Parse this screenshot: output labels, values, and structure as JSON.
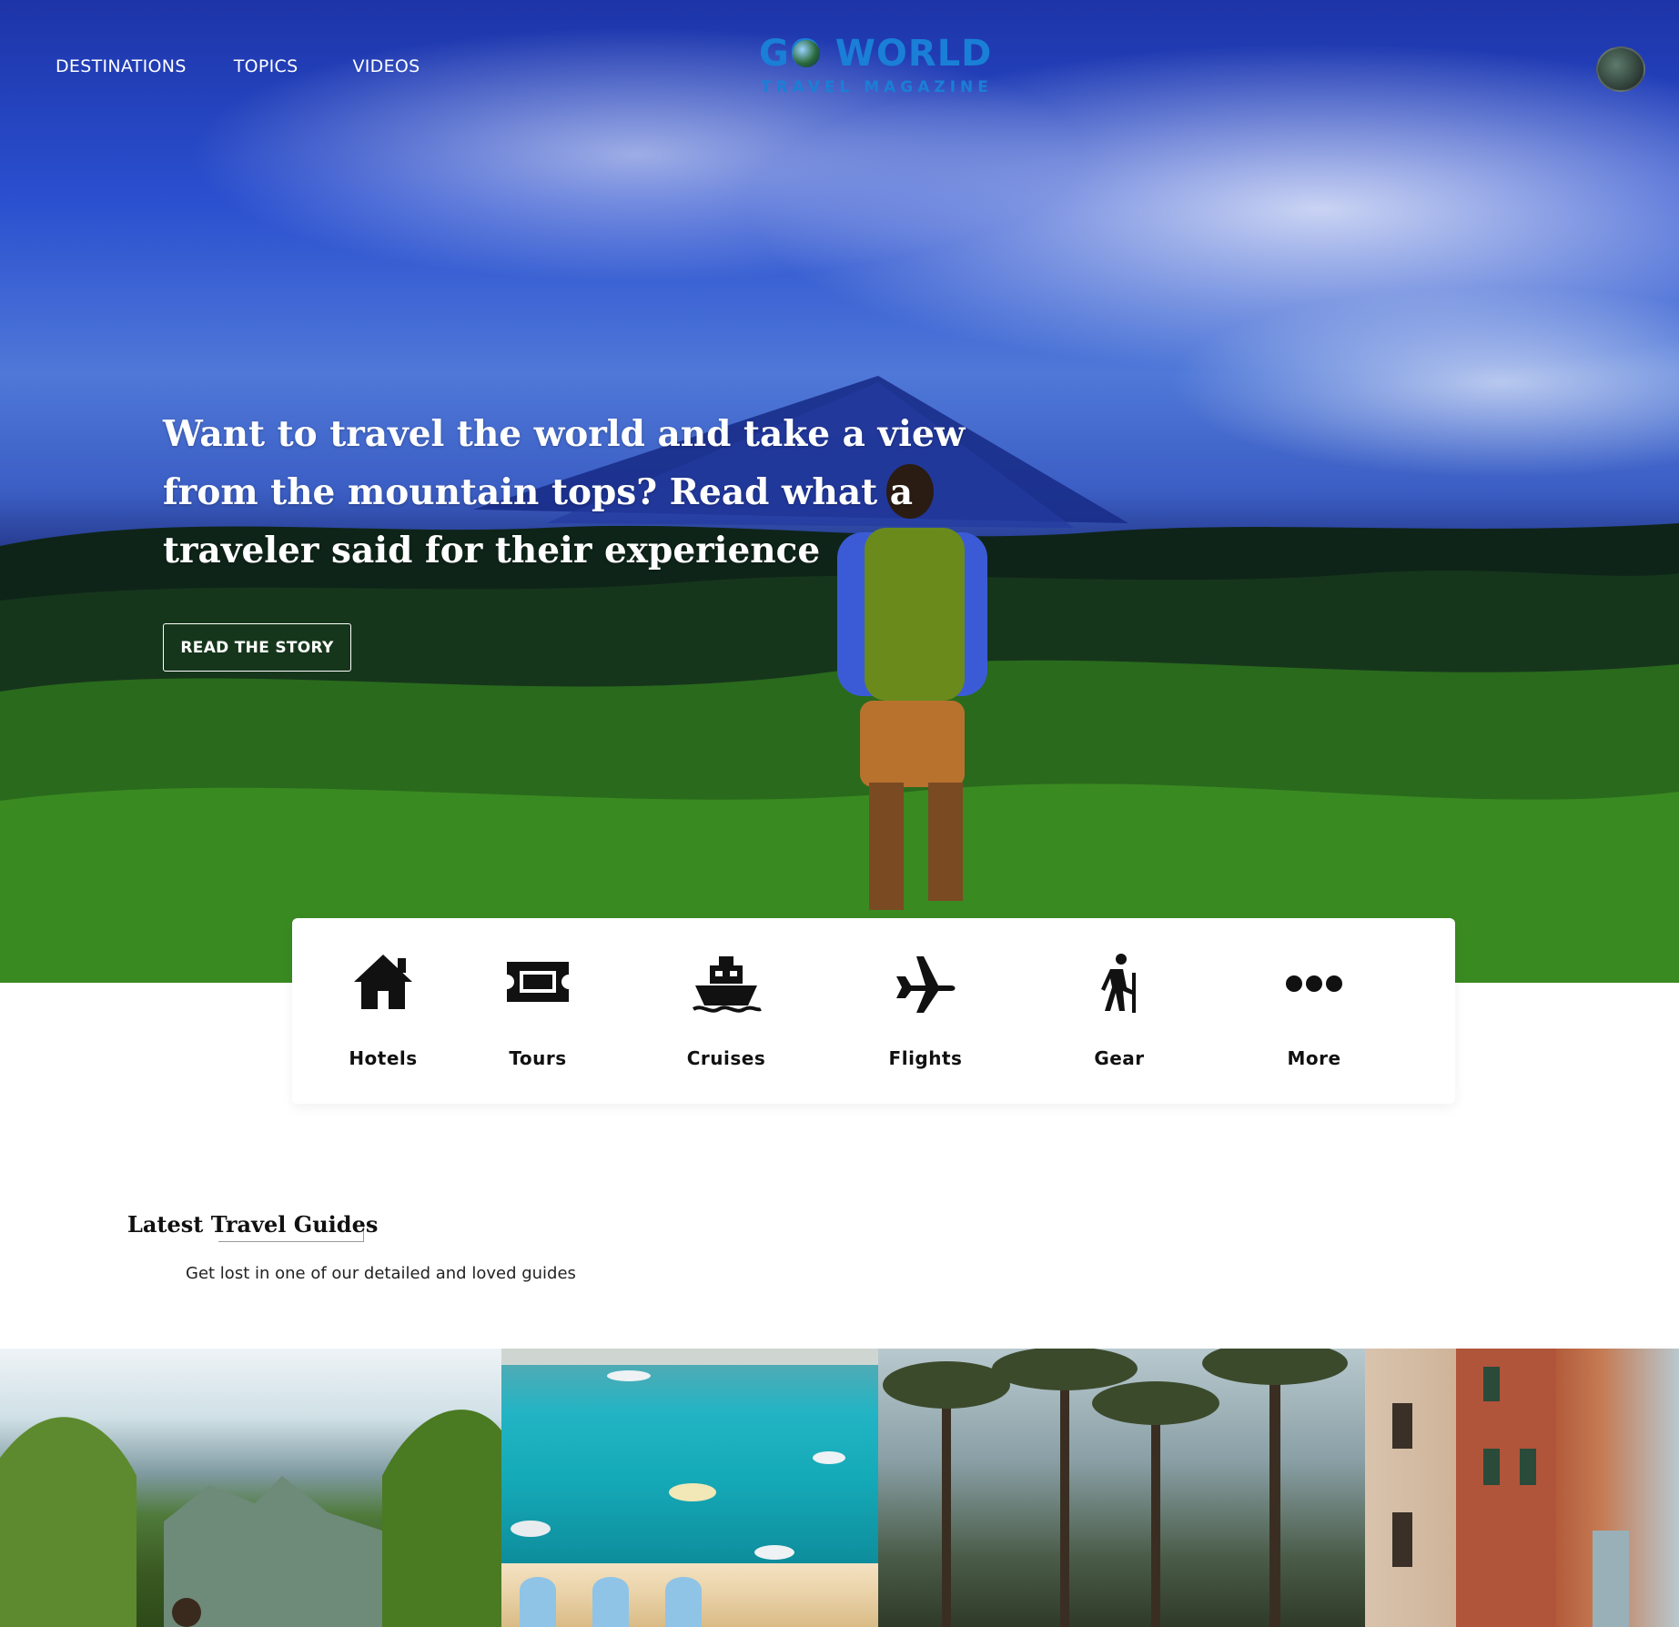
{
  "nav": {
    "items": [
      "DESTINATIONS",
      "TOPICS",
      "VIDEOS"
    ]
  },
  "logo": {
    "main": "GO WORLD",
    "sub": "TRAVEL MAGAZINE"
  },
  "hero": {
    "headline": "Want to travel the world and take a view from the mountain tops? Read what a traveler said for their experience",
    "cta": "READ THE STORY"
  },
  "categories": [
    {
      "label": "Hotels",
      "icon": "home-icon"
    },
    {
      "label": "Tours",
      "icon": "ticket-icon"
    },
    {
      "label": "Cruises",
      "icon": "ship-icon"
    },
    {
      "label": "Flights",
      "icon": "plane-icon"
    },
    {
      "label": "Gear",
      "icon": "hiking-icon"
    },
    {
      "label": "More",
      "icon": "more-dots-icon"
    }
  ],
  "guides": {
    "title": "Latest Travel Guides",
    "subtitle": "Get lost in one of our detailed and loved guides"
  },
  "colors": {
    "brand": "#1a7fd6",
    "hero_text": "#ffffff",
    "card_bg": "#ffffff"
  }
}
